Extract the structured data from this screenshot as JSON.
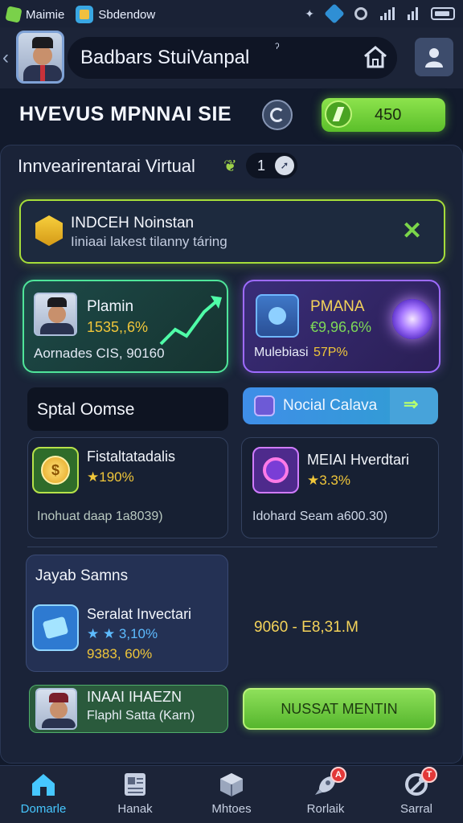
{
  "status_bar": {
    "app1": "Maimie",
    "app2": "Sbdendow"
  },
  "header": {
    "title": "Badbars StuiVanpal",
    "dot": "ˀ"
  },
  "mission": {
    "title": "HVEVUS MPNNAI SIE",
    "coins": "450"
  },
  "inventory": {
    "title": "Innvearirentarai Virtual",
    "count": "1"
  },
  "notice": {
    "title": "INDCEH Noinstan",
    "subtitle": "Iiniaai lakest tilanny táring"
  },
  "card_plamin": {
    "title": "Plamin",
    "value": "1535,,6%",
    "footer": "Aornades CIS, 90160"
  },
  "card_pmana": {
    "title": "PMANA",
    "value": "€9,96,6%",
    "footer_label": "Mulebiasi",
    "footer_value": "57P%"
  },
  "sections": {
    "left_label": "Sptal Oomse",
    "social_label": "Nocial Calava"
  },
  "item1": {
    "title": "Fistaltatadalis",
    "value": "★190%",
    "footer": "Inohuat daap 1a8039)"
  },
  "item2": {
    "title": "MEIAI Hverdtari",
    "value": "★3.3%",
    "footer": "Idohard Seam a600.30)"
  },
  "jayab": {
    "title": "Jayab Samns",
    "subtitle": "Seralat Invectari",
    "value1": "★ ★ 3,10%",
    "value2": "9383, 60%",
    "right_stat": "9060 - E8,31.M"
  },
  "bottom_card": {
    "title": "INAAI IHAEZN",
    "subtitle": "Flaphl Satta (Karn)",
    "button": "NUSSAT MENTIN"
  },
  "nav": [
    {
      "label": "Domarle",
      "icon": "home-icon",
      "active": true
    },
    {
      "label": "Hanak",
      "icon": "document-icon"
    },
    {
      "label": "Mhtoes",
      "icon": "box-icon"
    },
    {
      "label": "Rorlaik",
      "icon": "rocket-icon",
      "badge": "A"
    },
    {
      "label": "Sarral",
      "icon": "tools-icon",
      "badge": "T"
    }
  ],
  "colors": {
    "accent_green": "#8de34d",
    "accent_purple": "#9e6bff",
    "accent_blue": "#46c7ff",
    "gold": "#f0c63a"
  }
}
